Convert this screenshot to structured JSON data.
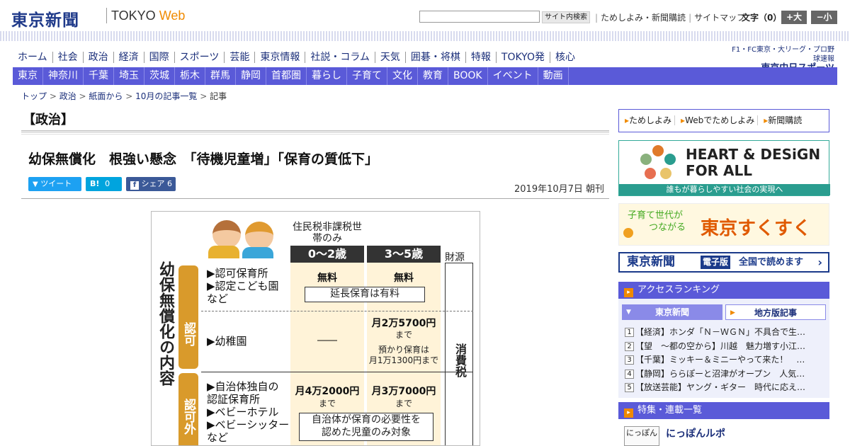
{
  "header": {
    "logo_jp": "東京新聞",
    "logo_en_a": "TOKYO ",
    "logo_en_b": "Web",
    "search_button": "サイト内検索",
    "links": [
      "ためしよみ・新聞購読",
      "サイトマップ"
    ],
    "font_size_label": "文字（0）",
    "size_up": "+大",
    "size_down": "−小"
  },
  "nav_main": [
    "ホーム",
    "社会",
    "政治",
    "経済",
    "国際",
    "スポーツ",
    "芸能",
    "東京情報",
    "社説・コラム",
    "天気",
    "囲碁・将棋",
    "特報",
    "TOKYO発",
    "核心"
  ],
  "chunichi": {
    "line1": "F1・FC東京・大リーグ・プロ野球速報",
    "line2": "東京中日スポーツ"
  },
  "nav_regional": [
    "東京",
    "神奈川",
    "千葉",
    "埼玉",
    "茨城",
    "栃木",
    "群馬",
    "静岡",
    "首都圏",
    "暮らし",
    "子育て",
    "文化",
    "教育",
    "BOOK",
    "イベント",
    "動画"
  ],
  "breadcrumb": [
    "トップ",
    "政治",
    "紙面から",
    "10月の記事一覧",
    "記事"
  ],
  "section_title": "【政治】",
  "headline": "幼保無償化　根強い懸念　「待機児童増」「保育の質低下」",
  "share": {
    "tweet": "ツイート",
    "hatena": "B!",
    "hatena_count": "0",
    "facebook": "シェア",
    "facebook_count": "6"
  },
  "pubdate": "2019年10月7日 朝刊",
  "figure": {
    "vertical_title": "幼保無償化の内容",
    "nontax_head": "住民税非課税世帯のみ",
    "age1": "0〜2歳",
    "age2": "3〜5歳",
    "fund": "財源",
    "tax": "消費税",
    "cat_licensed": "認可",
    "cat_unlicensed": "認可外",
    "row1_label": "▶認可保育所\n▶認定こども園\nなど",
    "row1_col1": "無料",
    "row1_col2": "無料",
    "row1_note": "延長保育は有料",
    "row2_label": "▶幼稚園",
    "row2_col1": "――",
    "row2_col2a": "月2万5700円",
    "row2_col2b": "まで",
    "row2_col2c": "預かり保育は",
    "row2_col2d": "月1万1300円まで",
    "row3_label": "▶自治体独自の\n認証保育所\n▶ベビーホテル\n▶ベビーシッター\nなど",
    "row3_col1a": "月4万2000円",
    "row3_col1b": "まで",
    "row3_col2a": "月3万7000円",
    "row3_col2b": "まで",
    "row3_note": "自治体が保育の必要性を\n認めた児童のみ対象"
  },
  "sidebar": {
    "links": [
      "ためしよみ",
      "Webでためしよみ",
      "新聞購読"
    ],
    "hd_title_1": "HEART & DESiGN",
    "hd_title_2": "FOR ALL",
    "hd_sub": "誰もが暮らしやすい社会の実現へ",
    "suku_small_1": "子育て世代が",
    "suku_small_2": "つながる",
    "suku_big": "東京すくすく",
    "denshi_jp": "東京新聞",
    "denshi_tag": "電子版",
    "denshi_read": "全国で読めます",
    "ranking_head": "アクセスランキング",
    "rank_tab1": "東京新聞",
    "rank_tab2": "地方版記事",
    "ranking": [
      "【経済】ホンダ「Ｎ－ＷＧＮ」不具合で生…",
      "【望　～都の空から】川越　魅力増す小江…",
      "【千葉】ミッキー＆ミニーやって来た！　…",
      "【静岡】ららぽーと沼津がオープン　人気…",
      "【放送芸能】ヤング・ギター　時代に応え…"
    ],
    "feature_head": "特集・連載一覧",
    "feature_thumb": "にっぽん",
    "feature_title": "にっぽんルポ"
  },
  "colors": {
    "brand_blue": "#1f3a8a",
    "nav_bar": "#5a5ad8",
    "accent_orange": "#f08a00"
  }
}
